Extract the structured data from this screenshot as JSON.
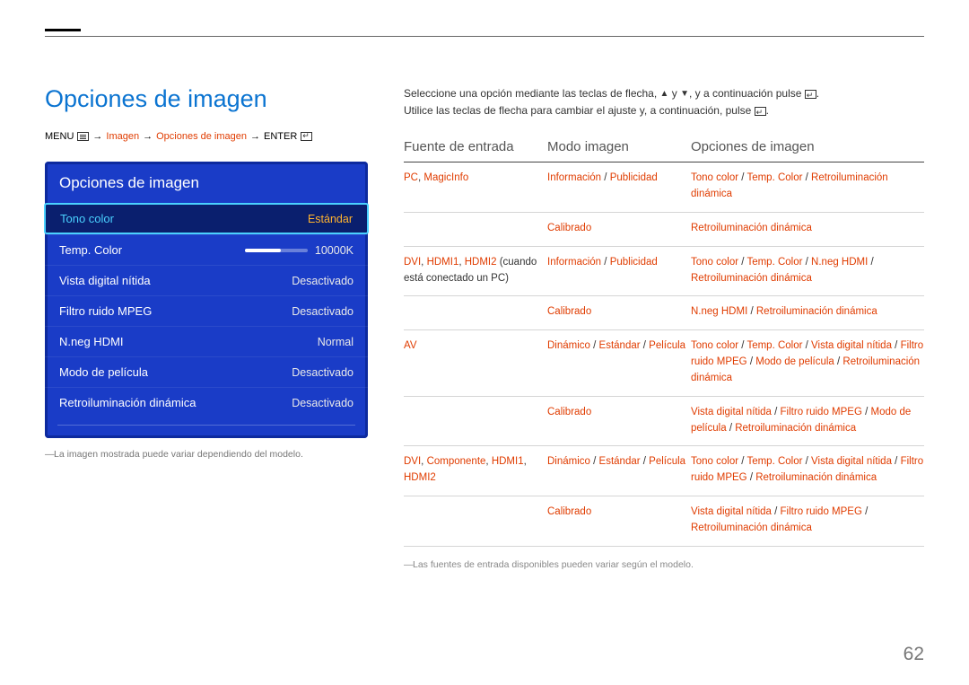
{
  "page_title": "Opciones de imagen",
  "breadcrumb": {
    "menu": "MENU",
    "imagen": "Imagen",
    "opciones": "Opciones de imagen",
    "enter": "ENTER"
  },
  "panel": {
    "title": "Opciones de imagen",
    "rows": [
      {
        "label": "Tono color",
        "value": "Estándar",
        "selected": true
      },
      {
        "label": "Temp. Color",
        "value": "10000K",
        "slider": true
      },
      {
        "label": "Vista digital nítida",
        "value": "Desactivado"
      },
      {
        "label": "Filtro ruido MPEG",
        "value": "Desactivado"
      },
      {
        "label": "N.neg HDMI",
        "value": "Normal"
      },
      {
        "label": "Modo de película",
        "value": "Desactivado"
      },
      {
        "label": "Retroiluminación dinámica",
        "value": "Desactivado"
      }
    ],
    "note": "La imagen mostrada puede variar dependiendo del modelo."
  },
  "instructions": {
    "line1a": "Seleccione una opción mediante las teclas de flecha, ",
    "line1b": " y ",
    "line1c": ", y a continuación pulse ",
    "line2a": "Utilice las teclas de flecha para cambiar el ajuste y, a continuación, pulse ",
    "dot": "."
  },
  "table": {
    "headers": [
      "Fuente de entrada",
      "Modo imagen",
      "Opciones de imagen"
    ],
    "rows": [
      {
        "c1": [
          {
            "t": "PC",
            "hl": true
          },
          {
            "t": ", ",
            "hl": false
          },
          {
            "t": "MagicInfo",
            "hl": true
          }
        ],
        "c2": [
          {
            "t": "Información",
            "hl": true
          },
          {
            "t": " / ",
            "hl": false
          },
          {
            "t": "Publicidad",
            "hl": true
          }
        ],
        "c3": [
          {
            "t": "Tono color",
            "hl": true
          },
          {
            "t": " / ",
            "hl": false
          },
          {
            "t": "Temp. Color",
            "hl": true
          },
          {
            "t": " / ",
            "hl": false
          },
          {
            "t": "Retroiluminación dinámica",
            "hl": true
          }
        ]
      },
      {
        "c1": [],
        "c2": [
          {
            "t": "Calibrado",
            "hl": true
          }
        ],
        "c3": [
          {
            "t": "Retroiluminación dinámica",
            "hl": true
          }
        ]
      },
      {
        "c1": [
          {
            "t": "DVI",
            "hl": true
          },
          {
            "t": ", ",
            "hl": false
          },
          {
            "t": "HDMI1",
            "hl": true
          },
          {
            "t": ", ",
            "hl": false
          },
          {
            "t": "HDMI2",
            "hl": true
          },
          {
            "t": " (cuando está conectado un PC)",
            "hl": false
          }
        ],
        "c2": [
          {
            "t": "Información",
            "hl": true
          },
          {
            "t": " / ",
            "hl": false
          },
          {
            "t": "Publicidad",
            "hl": true
          }
        ],
        "c3": [
          {
            "t": "Tono color",
            "hl": true
          },
          {
            "t": " / ",
            "hl": false
          },
          {
            "t": "Temp. Color",
            "hl": true
          },
          {
            "t": " / ",
            "hl": false
          },
          {
            "t": "N.neg HDMI",
            "hl": true
          },
          {
            "t": " / ",
            "hl": false
          },
          {
            "t": "Retroiluminación dinámica",
            "hl": true
          }
        ]
      },
      {
        "c1": [],
        "c2": [
          {
            "t": "Calibrado",
            "hl": true
          }
        ],
        "c3": [
          {
            "t": "N.neg HDMI",
            "hl": true
          },
          {
            "t": " / ",
            "hl": false
          },
          {
            "t": "Retroiluminación dinámica",
            "hl": true
          }
        ]
      },
      {
        "c1": [
          {
            "t": "AV",
            "hl": true
          }
        ],
        "c2": [
          {
            "t": "Dinámico",
            "hl": true
          },
          {
            "t": " / ",
            "hl": false
          },
          {
            "t": "Estándar",
            "hl": true
          },
          {
            "t": " / ",
            "hl": false
          },
          {
            "t": "Película",
            "hl": true
          }
        ],
        "c3": [
          {
            "t": "Tono color",
            "hl": true
          },
          {
            "t": " / ",
            "hl": false
          },
          {
            "t": "Temp. Color",
            "hl": true
          },
          {
            "t": " / ",
            "hl": false
          },
          {
            "t": "Vista digital nítida",
            "hl": true
          },
          {
            "t": " / ",
            "hl": false
          },
          {
            "t": "Filtro ruido MPEG",
            "hl": true
          },
          {
            "t": " / ",
            "hl": false
          },
          {
            "t": "Modo de película",
            "hl": true
          },
          {
            "t": " / ",
            "hl": false
          },
          {
            "t": "Retroiluminación dinámica",
            "hl": true
          }
        ]
      },
      {
        "c1": [],
        "c2": [
          {
            "t": "Calibrado",
            "hl": true
          }
        ],
        "c3": [
          {
            "t": "Vista digital nítida",
            "hl": true
          },
          {
            "t": " / ",
            "hl": false
          },
          {
            "t": "Filtro ruido MPEG",
            "hl": true
          },
          {
            "t": " / ",
            "hl": false
          },
          {
            "t": "Modo de película",
            "hl": true
          },
          {
            "t": " / ",
            "hl": false
          },
          {
            "t": "Retroiluminación dinámica",
            "hl": true
          }
        ]
      },
      {
        "c1": [
          {
            "t": "DVI",
            "hl": true
          },
          {
            "t": ", ",
            "hl": false
          },
          {
            "t": "Componente",
            "hl": true
          },
          {
            "t": ", ",
            "hl": false
          },
          {
            "t": "HDMI1",
            "hl": true
          },
          {
            "t": ", ",
            "hl": false
          },
          {
            "t": "HDMI2",
            "hl": true
          }
        ],
        "c2": [
          {
            "t": "Dinámico",
            "hl": true
          },
          {
            "t": " / ",
            "hl": false
          },
          {
            "t": "Estándar",
            "hl": true
          },
          {
            "t": " / ",
            "hl": false
          },
          {
            "t": "Película",
            "hl": true
          }
        ],
        "c3": [
          {
            "t": "Tono color",
            "hl": true
          },
          {
            "t": " / ",
            "hl": false
          },
          {
            "t": "Temp. Color",
            "hl": true
          },
          {
            "t": " / ",
            "hl": false
          },
          {
            "t": "Vista digital nítida",
            "hl": true
          },
          {
            "t": " / ",
            "hl": false
          },
          {
            "t": "Filtro ruido MPEG",
            "hl": true
          },
          {
            "t": " / ",
            "hl": false
          },
          {
            "t": "Retroiluminación dinámica",
            "hl": true
          }
        ]
      },
      {
        "c1": [],
        "c2": [
          {
            "t": "Calibrado",
            "hl": true
          }
        ],
        "c3": [
          {
            "t": "Vista digital nítida",
            "hl": true
          },
          {
            "t": " / ",
            "hl": false
          },
          {
            "t": "Filtro ruido MPEG",
            "hl": true
          },
          {
            "t": " / ",
            "hl": false
          },
          {
            "t": "Retroiluminación dinámica",
            "hl": true
          }
        ]
      }
    ],
    "footnote": "Las fuentes de entrada disponibles pueden variar según el modelo."
  },
  "page_number": "62"
}
